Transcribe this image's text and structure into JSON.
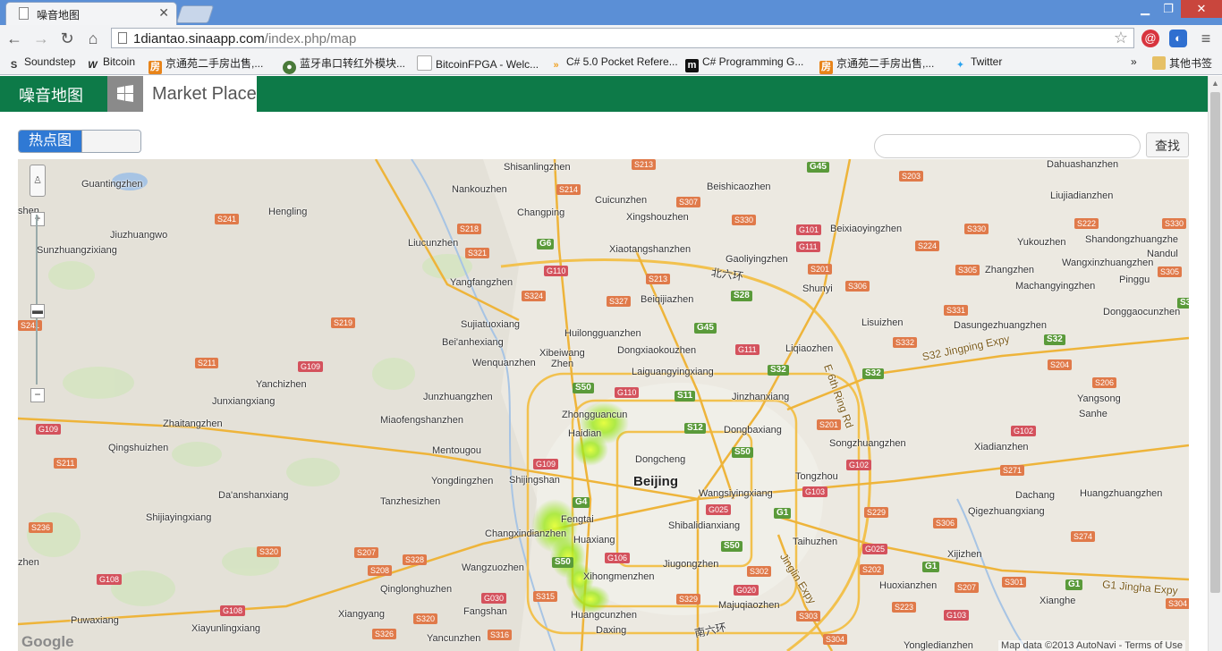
{
  "browser": {
    "tab_title": "噪音地图",
    "url_host": "1diantao.sinaapp.com",
    "url_path": "/index.php/map",
    "window_buttons": {
      "minimize": "▁",
      "maximize": "❐",
      "close": "✕"
    },
    "bookmarks": [
      {
        "label": "Soundstep",
        "icon": "S",
        "color": "#333333"
      },
      {
        "label": "Bitcoin",
        "icon": "W",
        "color": "#222222"
      },
      {
        "label": "京通苑二手房出售,...",
        "icon": "房",
        "color": "#e8841a"
      },
      {
        "label": "蓝牙串口转红外模块...",
        "icon": "●",
        "color": "#4a7a3a"
      },
      {
        "label": "BitcoinFPGA - Welc...",
        "icon": "",
        "color": "#ffffff"
      },
      {
        "label": "C# 5.0 Pocket Refere...",
        "icon": "»",
        "color": "#f0a020"
      },
      {
        "label": "C# Programming G...",
        "icon": "m",
        "color": "#111111"
      },
      {
        "label": "京通苑二手房出售,...",
        "icon": "房",
        "color": "#e8841a"
      },
      {
        "label": "Twitter",
        "icon": "✦",
        "color": "#2aa3ef"
      }
    ],
    "bookmarks_overflow": "»",
    "other_bookmarks": "其他书签"
  },
  "navbar": {
    "brand": "噪音地图",
    "market_place": "Market Place",
    "accent": "#0d7a48"
  },
  "controls": {
    "toggle_label": "热点图",
    "search_placeholder": "",
    "search_button": "查找"
  },
  "map": {
    "zoom_in": "+",
    "zoom_out": "−",
    "logo": "Google",
    "attribution": "Map data ©2013 AutoNavi - Terms of Use",
    "labels": {
      "beijing": "Beijing",
      "dahuashanzhen": "Dahuashanzhen",
      "shisanlingzhen": "Shisanlingzhen",
      "beishicaozhen": "Beishicaozhen",
      "guantingzhen": "Guantingzhen",
      "nankouzhen": "Nankouzhen",
      "cuicunzhen": "Cuicunzhen",
      "liujiadianzhen": "Liujiadianzhen",
      "changping": "Changping",
      "xingshouzhen": "Xingshouzhen",
      "hengling": "Hengling",
      "jiuzhuangwo": "Jiuzhuangwo",
      "beixiaoyingzhen": "Beixiaoyingzhen",
      "sunzhuangzixiang": "Sunzhuangzixiang",
      "liucunzhen": "Liucunzhen",
      "xiaotangshanzhen": "Xiaotangshanzhen",
      "yukouzhen": "Yukouzhen",
      "shandongzhuangzhen": "Shandongzhuangzhe",
      "gaoliyingzhen": "Gaoliyingzhen",
      "nandul": "Nandul",
      "wangxinzhuangzhen": "Wangxinzhuangzhen",
      "beiliuhuan": "北六环",
      "zhangzhen": "Zhangzhen",
      "yangfangzhen": "Yangfangzhen",
      "shunyi": "Shunyi",
      "pinggu": "Pinggu",
      "machangyingzhen": "Machangyingzhen",
      "beiqijiazhen": "Beiqijiazhen",
      "donggaocunzhen": "Donggaocunzhen",
      "sujiatuoxiang": "Sujiatuoxiang",
      "lisuizhen": "Lisuizhen",
      "huilongguanzhen": "Huilongguanzhen",
      "dasungezhuangzhen": "Dasungezhuangzhen",
      "beianhexiang": "Bei'anhexiang",
      "dongxiaokouzhen": "Dongxiaokouzhen",
      "liqiaozhen": "Liqiaozhen",
      "s32_jingping": "S32 Jingping Expy",
      "xibeiwang": "Xibeiwang",
      "zhen": "Zhen",
      "wenquanzhen": "Wenquanzhen",
      "laiguangyingxiang": "Laiguangyingxiang",
      "e6th_ring": "E 6th Ring Rd",
      "yanchizhen": "Yanchizhen",
      "junzhuangzhen": "Junzhuangzhen",
      "jinzhanxiang": "Jinzhanxiang",
      "yangsong": "Yangsong",
      "junxiangxiang": "Junxiangxiang",
      "zhongguancun": "Zhongguancun",
      "miaofengshanzhen": "Miaofengshanzhen",
      "sanhe": "Sanhe",
      "zhaitangzhen": "Zhaitangzhen",
      "dongbaxiang": "Dongbaxiang",
      "haidian": "Haidian",
      "songzhuangzhen": "Songzhuangzhen",
      "xiadianzhen": "Xiadianzhen",
      "qingshuizhen": "Qingshuizhen",
      "mentougou": "Mentougou",
      "dongcheng": "Dongcheng",
      "yongdingzhen": "Yongdingzhen",
      "shijingshan": "Shijingshan",
      "tongzhou": "Tongzhou",
      "daanshanxiang": "Da'anshanxiang",
      "wangsiyingxiang": "Wangsiyingxiang",
      "dachang": "Dachang",
      "huangzhuangzhen": "Huangzhuangzhen",
      "tanzhesizhen": "Tanzhesizhen",
      "fengtai": "Fengtai",
      "shijiayingxiang": "Shijiayingxiang",
      "qigezhuangxiang": "Qigezhuangxiang",
      "changxindianzhen": "Changxindianzhen",
      "shibalidianxiang": "Shibalidianxiang",
      "huaxiang": "Huaxiang",
      "taihuzhen": "Taihuzhen",
      "xijizhen": "Xijizhen",
      "wangzuozhen": "Wangzuozhen",
      "jiugongzhen": "Jiugongzhen",
      "xihongmenzhen": "Xihongmenzhen",
      "huoxianzhen": "Huoxianzhen",
      "jinglin_expy": "Jinglin Expy",
      "qinglonghuzhen": "Qinglonghuzhen",
      "g1_jingha": "G1 Jingha Expy",
      "xianghe": "Xianghe",
      "majuqiaozhen": "Majuqiaozhen",
      "fangshan": "Fangshan",
      "huangcunzhen": "Huangcunzhen",
      "xiangyang": "Xiangyang",
      "puwaxiang": "Puwaxiang",
      "nanliuhuan": "南六环",
      "xiayunlingxiang": "Xiayunlingxiang",
      "yancunzhen": "Yancunzhen",
      "daxing": "Daxing",
      "yongledianzhen": "Yongledianzhen",
      "shenzhen_left": "shen",
      "zhen_left": "zhen"
    }
  }
}
